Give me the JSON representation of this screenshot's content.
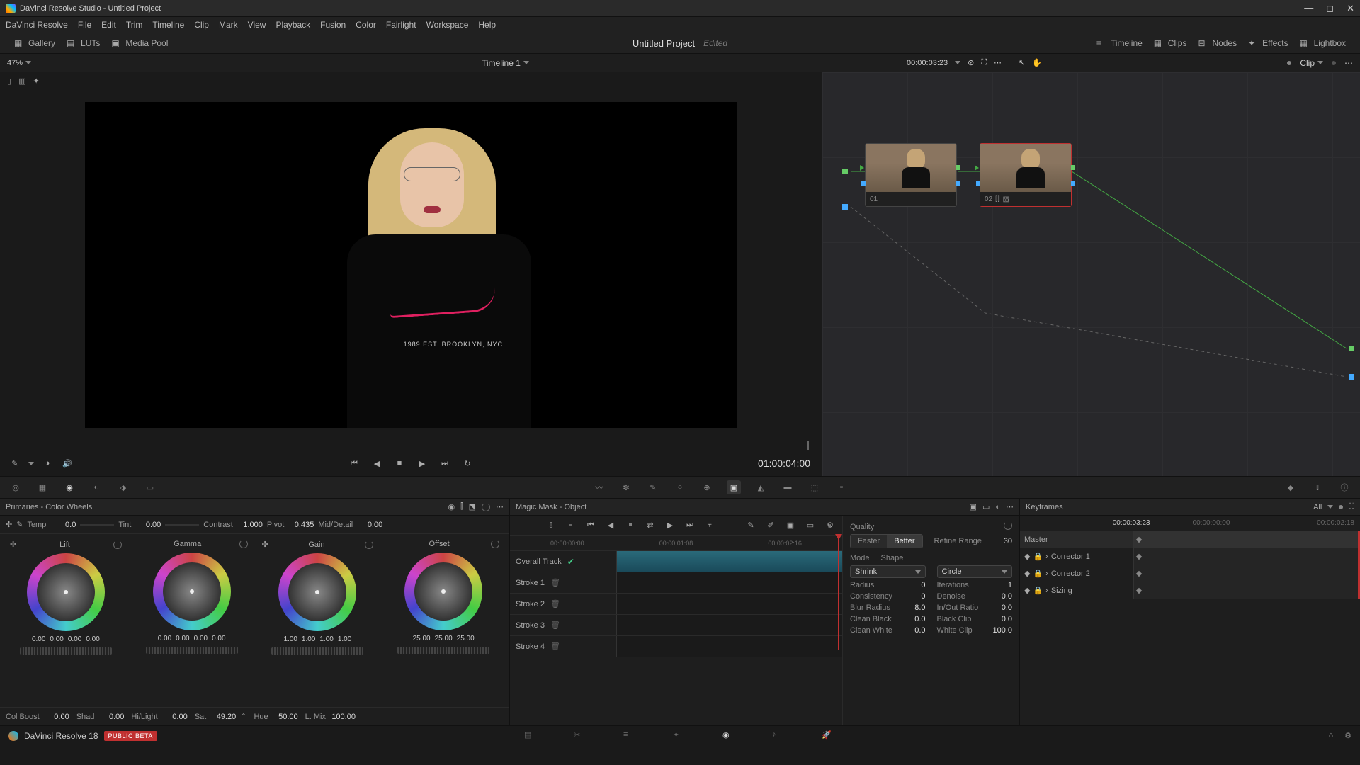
{
  "window": {
    "title": "DaVinci Resolve Studio - Untitled Project"
  },
  "menu": [
    "DaVinci Resolve",
    "File",
    "Edit",
    "Trim",
    "Timeline",
    "Clip",
    "Mark",
    "View",
    "Playback",
    "Fusion",
    "Color",
    "Fairlight",
    "Workspace",
    "Help"
  ],
  "top_tools": {
    "gallery": "Gallery",
    "luts": "LUTs",
    "mediapool": "Media Pool",
    "timeline": "Timeline",
    "clips": "Clips",
    "nodes": "Nodes",
    "effects": "Effects",
    "lightbox": "Lightbox"
  },
  "project": {
    "name": "Untitled Project",
    "status": "Edited"
  },
  "subbar": {
    "zoom": "47%",
    "timeline_name": "Timeline 1",
    "timecode": "00:00:03:23",
    "clip_label": "Clip"
  },
  "viewer": {
    "shirt_text": "1989 EST. BROOKLYN, NYC",
    "timecode": "01:00:04:00"
  },
  "nodes": {
    "n1": "01",
    "n2": "02"
  },
  "primaries": {
    "title": "Primaries - Color Wheels",
    "params": {
      "temp_l": "Temp",
      "temp_v": "0.0",
      "tint_l": "Tint",
      "tint_v": "0.00",
      "contrast_l": "Contrast",
      "contrast_v": "1.000",
      "pivot_l": "Pivot",
      "pivot_v": "0.435",
      "md_l": "Mid/Detail",
      "md_v": "0.00"
    },
    "wheels": {
      "lift": {
        "name": "Lift",
        "v": [
          "0.00",
          "0.00",
          "0.00",
          "0.00"
        ]
      },
      "gamma": {
        "name": "Gamma",
        "v": [
          "0.00",
          "0.00",
          "0.00",
          "0.00"
        ]
      },
      "gain": {
        "name": "Gain",
        "v": [
          "1.00",
          "1.00",
          "1.00",
          "1.00"
        ]
      },
      "offset": {
        "name": "Offset",
        "v": [
          "25.00",
          "25.00",
          "25.00"
        ]
      }
    },
    "bottom": {
      "colboost_l": "Col Boost",
      "colboost_v": "0.00",
      "shad_l": "Shad",
      "shad_v": "0.00",
      "hl_l": "Hi/Light",
      "hl_v": "0.00",
      "sat_l": "Sat",
      "sat_v": "49.20",
      "hue_l": "Hue",
      "hue_v": "50.00",
      "lmix_l": "L. Mix",
      "lmix_v": "100.00"
    }
  },
  "magicmask": {
    "title": "Magic Mask - Object",
    "timeline_ticks": [
      "00:00:00:00",
      "00:00:01:08",
      "00:00:02:16"
    ],
    "rows": {
      "overall": "Overall Track",
      "s1": "Stroke 1",
      "s2": "Stroke 2",
      "s3": "Stroke 3",
      "s4": "Stroke 4"
    },
    "quality": {
      "label": "Quality",
      "faster": "Faster",
      "better": "Better",
      "refine_l": "Refine Range",
      "refine_v": "30"
    },
    "mode_l": "Mode",
    "mode_v": "Shrink",
    "shape_l": "Shape",
    "shape_v": "Circle",
    "radius_l": "Radius",
    "radius_v": "0",
    "iter_l": "Iterations",
    "iter_v": "1",
    "consist_l": "Consistency",
    "consist_v": "0",
    "denoise_l": "Denoise",
    "denoise_v": "0.0",
    "blur_l": "Blur Radius",
    "blur_v": "8.0",
    "inout_l": "In/Out Ratio",
    "inout_v": "0.0",
    "cblack_l": "Clean Black",
    "cblack_v": "0.0",
    "bclip_l": "Black Clip",
    "bclip_v": "0.0",
    "cwhite_l": "Clean White",
    "cwhite_v": "0.0",
    "wclip_l": "White Clip",
    "wclip_v": "100.0"
  },
  "keyframes": {
    "title": "Keyframes",
    "all": "All",
    "tc1": "00:00:03:23",
    "tc2": "00:00:00:00",
    "tc3": "00:00:02:18",
    "master": "Master",
    "c1": "Corrector 1",
    "c2": "Corrector 2",
    "sizing": "Sizing"
  },
  "pagebar": {
    "app": "DaVinci Resolve 18",
    "beta": "PUBLIC BETA"
  }
}
